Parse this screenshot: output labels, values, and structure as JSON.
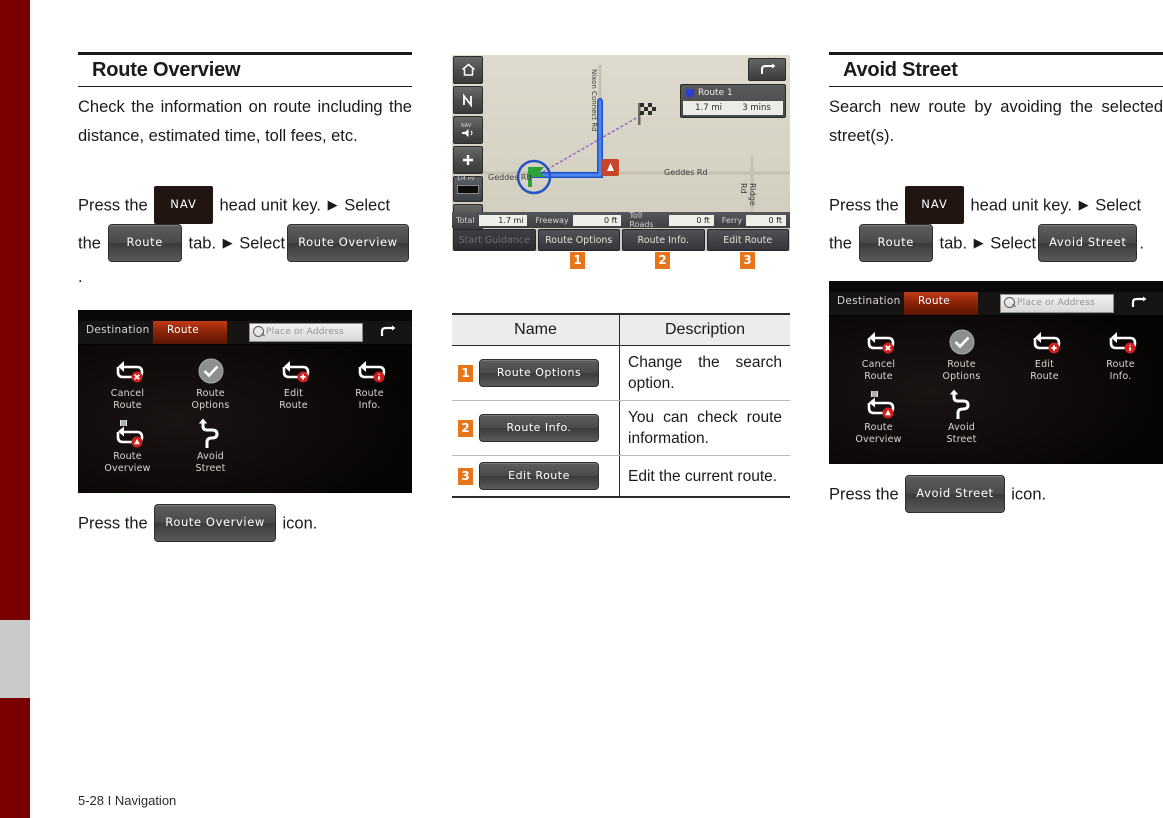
{
  "page": {
    "footer": "5-28 I Navigation",
    "accent_orange": "#e8751a",
    "edge_bar_color": "#7a0000"
  },
  "left": {
    "title": "Route Overview",
    "intro": "Check the information on route including the distance, estimated time, toll fees, etc.",
    "press_pre": "Press the",
    "nav_key": "NAV",
    "press_mid": "head unit key.",
    "select1": "Select",
    "the": "the",
    "tab_chip": "Route",
    "tab_word": "tab.",
    "select2": "Select",
    "target_chip": "Route Overview",
    "period": ".",
    "caption_pre": "Press the",
    "caption_chip": "Route Overview",
    "caption_post": "icon."
  },
  "right": {
    "title": "Avoid Street",
    "intro": "Search new route by avoiding the selected street(s).",
    "press_pre": "Press the",
    "nav_key": "NAV",
    "press_mid": "head unit key.",
    "select1": "Select",
    "the": "the",
    "tab_chip": "Route",
    "tab_word": "tab.",
    "select2": "Select",
    "target_chip": "Avoid Street",
    "period": ".",
    "caption_pre": "Press the",
    "caption_chip": "Avoid Street",
    "caption_post": "icon."
  },
  "navui": {
    "tab_destination": "Destination",
    "tab_route": "Route",
    "search_placeholder": "Place or Address",
    "items": [
      {
        "label1": "Cancel",
        "label2": "Route",
        "icon": "cancel-route-icon"
      },
      {
        "label1": "Route",
        "label2": "Options",
        "icon": "route-options-icon"
      },
      {
        "label1": "Edit",
        "label2": "Route",
        "icon": "edit-route-icon"
      },
      {
        "label1": "Route",
        "label2": "Info.",
        "icon": "route-info-icon"
      },
      {
        "label1": "Route",
        "label2": "Overview",
        "icon": "route-overview-icon"
      },
      {
        "label1": "Avoid",
        "label2": "Street",
        "icon": "avoid-street-icon"
      }
    ]
  },
  "map": {
    "route_name": "Route 1",
    "route_distance": "1.7 mi",
    "route_time": "3 mins",
    "labels": {
      "geddes": "Geddes Rd",
      "geddes2": "Geddes Rd",
      "ridge": "Ridge Rd",
      "connect": "Nixon Connect Rd"
    },
    "stats": [
      {
        "label": "Total",
        "value": "1.7 mi"
      },
      {
        "label": "Freeway",
        "value": "0 ft"
      },
      {
        "label": "Toll Roads",
        "value": "0 ft"
      },
      {
        "label": "Ferry",
        "value": "0 ft"
      }
    ],
    "buttons": [
      {
        "label": "Start Guidance",
        "dim": true
      },
      {
        "label": "Route Options",
        "dim": false
      },
      {
        "label": "Route Info.",
        "dim": false
      },
      {
        "label": "Edit Route",
        "dim": false
      }
    ],
    "markers": [
      "1",
      "2",
      "3"
    ],
    "scale_label": "1/4 mi"
  },
  "table": {
    "header": {
      "name": "Name",
      "description": "Description"
    },
    "rows": [
      {
        "num": "1",
        "chip": "Route Options",
        "desc": "Change the search option."
      },
      {
        "num": "2",
        "chip": "Route Info.",
        "desc": "You can check route information."
      },
      {
        "num": "3",
        "chip": "Edit Route",
        "desc": "Edit the current route."
      }
    ]
  }
}
